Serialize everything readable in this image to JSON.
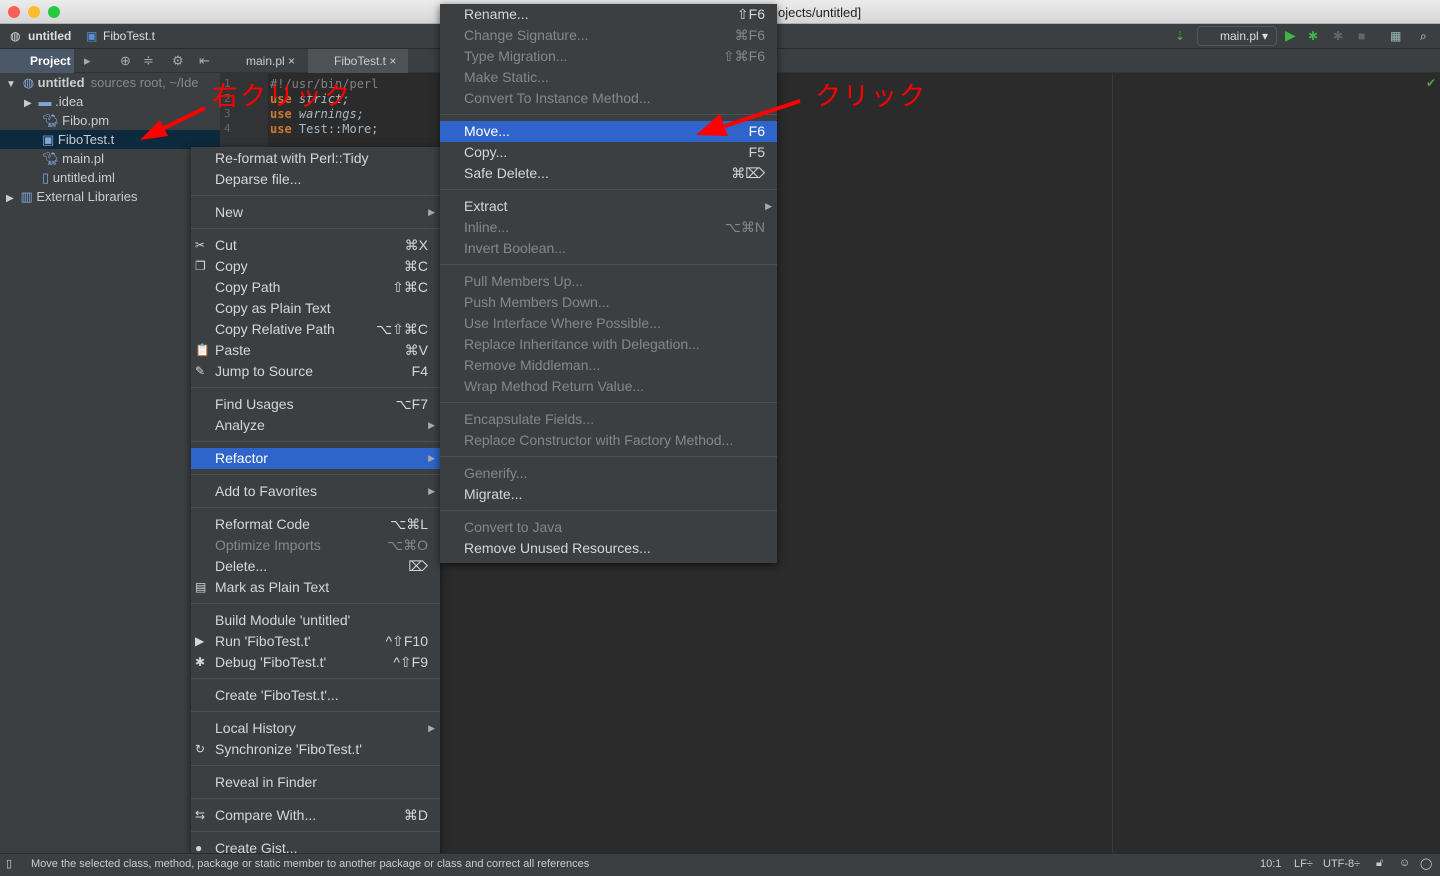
{
  "window": {
    "title": "ojects/untitled]"
  },
  "navbar": {
    "crumbs": [
      "untitled",
      "FiboTest.t"
    ],
    "run_config": "main.pl"
  },
  "toolwindow": {
    "label": "Project"
  },
  "tabs": [
    "main.pl",
    "FiboTest.t"
  ],
  "tree": [
    {
      "label": "untitled",
      "hint": "sources root, ~/Ide",
      "level": 0,
      "icon": "module-icon"
    },
    {
      "label": ".idea",
      "level": 1,
      "icon": "folder-icon"
    },
    {
      "label": "Fibo.pm",
      "level": 1,
      "icon": "perl-file-icon"
    },
    {
      "label": "FiboTest.t",
      "level": 1,
      "icon": "test-file-icon",
      "selected": true
    },
    {
      "label": "main.pl",
      "level": 1,
      "icon": "perl-file-icon"
    },
    {
      "label": "untitled.iml",
      "level": 1,
      "icon": "iml-file-icon"
    },
    {
      "label": "External Libraries",
      "level": 0,
      "icon": "libraries-icon"
    }
  ],
  "editor": {
    "line_numbers": [
      "1",
      "2",
      "3",
      "4"
    ],
    "lines": [
      [
        "",
        "#!/usr/bin/perl"
      ],
      [
        "use",
        "strict;"
      ],
      [
        "use",
        "warnings;"
      ],
      [
        "use",
        "Test::More;"
      ]
    ]
  },
  "context_menu": [
    {
      "label": "Re-format with Perl::Tidy"
    },
    {
      "label": "Deparse file..."
    },
    {
      "sep": true
    },
    {
      "label": "New",
      "submenu": true
    },
    {
      "sep": true
    },
    {
      "label": "Cut",
      "shortcut": "⌘X",
      "icon": "✂"
    },
    {
      "label": "Copy",
      "shortcut": "⌘C",
      "icon": "❐"
    },
    {
      "label": "Copy Path",
      "shortcut": "⇧⌘C"
    },
    {
      "label": "Copy as Plain Text"
    },
    {
      "label": "Copy Relative Path",
      "shortcut": "⌥⇧⌘C"
    },
    {
      "label": "Paste",
      "shortcut": "⌘V",
      "icon": "📋"
    },
    {
      "label": "Jump to Source",
      "shortcut": "F4",
      "icon": "✎"
    },
    {
      "sep": true
    },
    {
      "label": "Find Usages",
      "shortcut": "⌥F7"
    },
    {
      "label": "Analyze",
      "submenu": true
    },
    {
      "sep": true
    },
    {
      "label": "Refactor",
      "submenu": true,
      "selected": true
    },
    {
      "sep": true
    },
    {
      "label": "Add to Favorites",
      "submenu": true
    },
    {
      "sep": true
    },
    {
      "label": "Reformat Code",
      "shortcut": "⌥⌘L"
    },
    {
      "label": "Optimize Imports",
      "shortcut": "⌥⌘O",
      "disabled": true
    },
    {
      "label": "Delete...",
      "shortcut": "⌦"
    },
    {
      "label": "Mark as Plain Text",
      "icon": "▤"
    },
    {
      "sep": true
    },
    {
      "label": "Build Module 'untitled'"
    },
    {
      "label": "Run 'FiboTest.t'",
      "shortcut": "^⇧F10",
      "icon": "▶"
    },
    {
      "label": "Debug 'FiboTest.t'",
      "shortcut": "^⇧F9",
      "icon": "✱"
    },
    {
      "sep": true
    },
    {
      "label": "Create 'FiboTest.t'..."
    },
    {
      "sep": true
    },
    {
      "label": "Local History",
      "submenu": true
    },
    {
      "label": "Synchronize 'FiboTest.t'",
      "icon": "↻"
    },
    {
      "sep": true
    },
    {
      "label": "Reveal in Finder"
    },
    {
      "sep": true
    },
    {
      "label": "Compare With...",
      "shortcut": "⌘D",
      "icon": "⇆"
    },
    {
      "sep": true
    },
    {
      "label": "Create Gist...",
      "icon": "●"
    }
  ],
  "refactor_menu": [
    {
      "label": "Rename...",
      "shortcut": "⇧F6"
    },
    {
      "label": "Change Signature...",
      "shortcut": "⌘F6",
      "disabled": true
    },
    {
      "label": "Type Migration...",
      "shortcut": "⇧⌘F6",
      "disabled": true
    },
    {
      "label": "Make Static...",
      "disabled": true
    },
    {
      "label": "Convert To Instance Method...",
      "disabled": true
    },
    {
      "sep": true
    },
    {
      "label": "Move...",
      "shortcut": "F6",
      "selected": true
    },
    {
      "label": "Copy...",
      "shortcut": "F5"
    },
    {
      "label": "Safe Delete...",
      "shortcut": "⌘⌦"
    },
    {
      "sep": true
    },
    {
      "label": "Extract",
      "submenu": true
    },
    {
      "label": "Inline...",
      "shortcut": "⌥⌘N",
      "disabled": true
    },
    {
      "label": "Invert Boolean...",
      "disabled": true
    },
    {
      "sep": true
    },
    {
      "label": "Pull Members Up...",
      "disabled": true
    },
    {
      "label": "Push Members Down...",
      "disabled": true
    },
    {
      "label": "Use Interface Where Possible...",
      "disabled": true
    },
    {
      "label": "Replace Inheritance with Delegation...",
      "disabled": true
    },
    {
      "label": "Remove Middleman...",
      "disabled": true
    },
    {
      "label": "Wrap Method Return Value...",
      "disabled": true
    },
    {
      "sep": true
    },
    {
      "label": "Encapsulate Fields...",
      "disabled": true
    },
    {
      "label": "Replace Constructor with Factory Method...",
      "disabled": true
    },
    {
      "sep": true
    },
    {
      "label": "Generify...",
      "disabled": true
    },
    {
      "label": "Migrate..."
    },
    {
      "sep": true
    },
    {
      "label": "Convert to Java",
      "disabled": true
    },
    {
      "label": "Remove Unused Resources..."
    }
  ],
  "annotations": {
    "right_click": "右クリック",
    "click": "クリック"
  },
  "status": {
    "message": "Move the selected class, method, package or static member to another package or class and correct all references",
    "position": "10:1",
    "line_sep": "LF÷",
    "encoding": "UTF-8÷"
  }
}
